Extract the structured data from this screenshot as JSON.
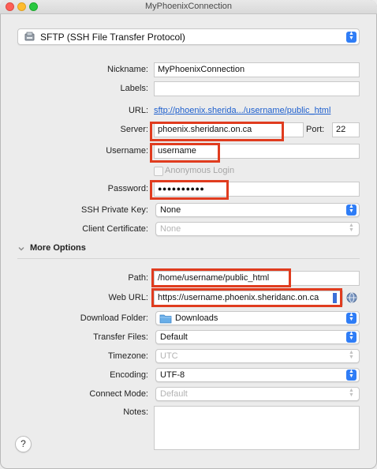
{
  "window": {
    "title": "MyPhoenixConnection"
  },
  "protocol": {
    "selected": "SFTP (SSH File Transfer Protocol)"
  },
  "form": {
    "nickname": {
      "label": "Nickname:",
      "value": "MyPhoenixConnection"
    },
    "labels": {
      "label": "Labels:",
      "value": ""
    },
    "url": {
      "label": "URL:",
      "value": "sftp://phoenix.sherida.../username/public_html"
    },
    "server": {
      "label": "Server:",
      "value": "phoenix.sheridanc.on.ca"
    },
    "port": {
      "label": "Port:",
      "value": "22"
    },
    "username": {
      "label": "Username:",
      "value": "username"
    },
    "anonymous": {
      "label": "Anonymous Login",
      "checked": false
    },
    "password": {
      "label": "Password:",
      "value": "●●●●●●●●●●"
    },
    "ssh_key": {
      "label": "SSH Private Key:",
      "value": "None"
    },
    "client_cert": {
      "label": "Client Certificate:",
      "value": "None"
    }
  },
  "more_options": {
    "label": "More Options",
    "path": {
      "label": "Path:",
      "value": "/home/username/public_html"
    },
    "web_url": {
      "label": "Web URL:",
      "value": "https://username.phoenix.sheridanc.on.ca"
    },
    "download_folder": {
      "label": "Download Folder:",
      "value": "Downloads"
    },
    "transfer_files": {
      "label": "Transfer Files:",
      "value": "Default"
    },
    "timezone": {
      "label": "Timezone:",
      "value": "UTC"
    },
    "encoding": {
      "label": "Encoding:",
      "value": "UTF-8"
    },
    "connect_mode": {
      "label": "Connect Mode:",
      "value": "Default"
    },
    "notes": {
      "label": "Notes:",
      "value": ""
    }
  },
  "help": {
    "label": "?"
  },
  "colors": {
    "highlight": "#e03c1f",
    "accent": "#2f7df6",
    "link": "#1d5fce"
  },
  "icons": [
    "disk-icon",
    "folder-icon",
    "globe-icon",
    "chevron-down-icon",
    "updown-arrows-icon"
  ]
}
